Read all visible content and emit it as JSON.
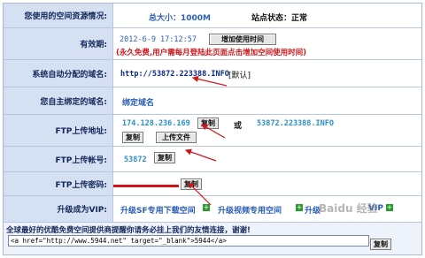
{
  "header": {
    "label": "您使用的空间资源情况:",
    "size": "总大小：1000M",
    "status": "站点状态：正常"
  },
  "validity": {
    "label": "有效期:",
    "date": "2012-6-9 17:12:57",
    "add_time_button": "增加使用时间",
    "notice": "(永久免费,用户需每月登陆此页面点击增加空间使用时间)"
  },
  "domain": {
    "label": "系统自动分配的域名:",
    "value": "http://53872.223388.INFO",
    "default": "[默认]"
  },
  "bound": {
    "label": "您自主绑定的域名:",
    "link": "绑定域名"
  },
  "ftp_addr": {
    "label": "FTP上传地址:",
    "ip": "174.128.236.169",
    "copy": "复制",
    "or": "或",
    "host": "53872.223388.INFO",
    "copy2": "复制",
    "upload": "上传文件"
  },
  "ftp_user": {
    "label": "FTP上传帐号:",
    "value": "53872",
    "copy": "复制"
  },
  "ftp_pass": {
    "label": "FTP上传密码:",
    "copy": "复制"
  },
  "upgrade": {
    "label": "升级成为VIP:",
    "sf": "升级SF专用下载空间",
    "video": "升级视频专用空间",
    "vip": "升级",
    "vip_tail": "VIP",
    "watermark": "Baidu 经验"
  },
  "footer": {
    "notice": "全球最好的优酷免费空间提供商提醒你请务必挂上我们的友情连接，谢谢!",
    "code": "<a href=\"http://www.5944.net\" target=\"_blank\">5944</a>",
    "copy": "复制"
  },
  "colors": {
    "label_bg": "#d6e0f3",
    "accent_blue": "#2c5fb8",
    "red": "#d0151a",
    "green": "#2a9a2a"
  }
}
